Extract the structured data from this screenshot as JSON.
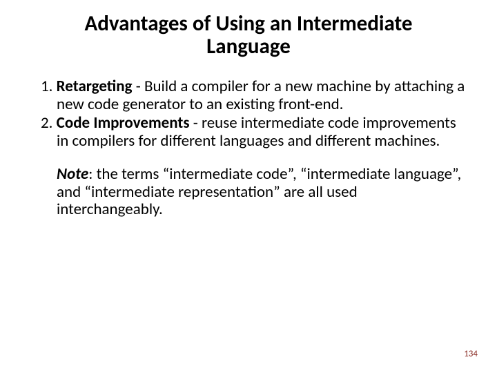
{
  "title": "Advantages of Using an Intermediate Language",
  "items": [
    {
      "num": "1. ",
      "lead": "Retargeting",
      "rest": " - Build a compiler for a new machine by attaching a new code generator to an existing front-end."
    },
    {
      "num": "2. ",
      "lead": "Code Improvements",
      "rest": " - reuse intermediate code improvements in compilers for different languages and different machines."
    }
  ],
  "note": {
    "lead": "Note",
    "rest": ": the terms “intermediate code”, “intermediate language”, and “intermediate representation” are all used interchangeably."
  },
  "page_number": "134"
}
